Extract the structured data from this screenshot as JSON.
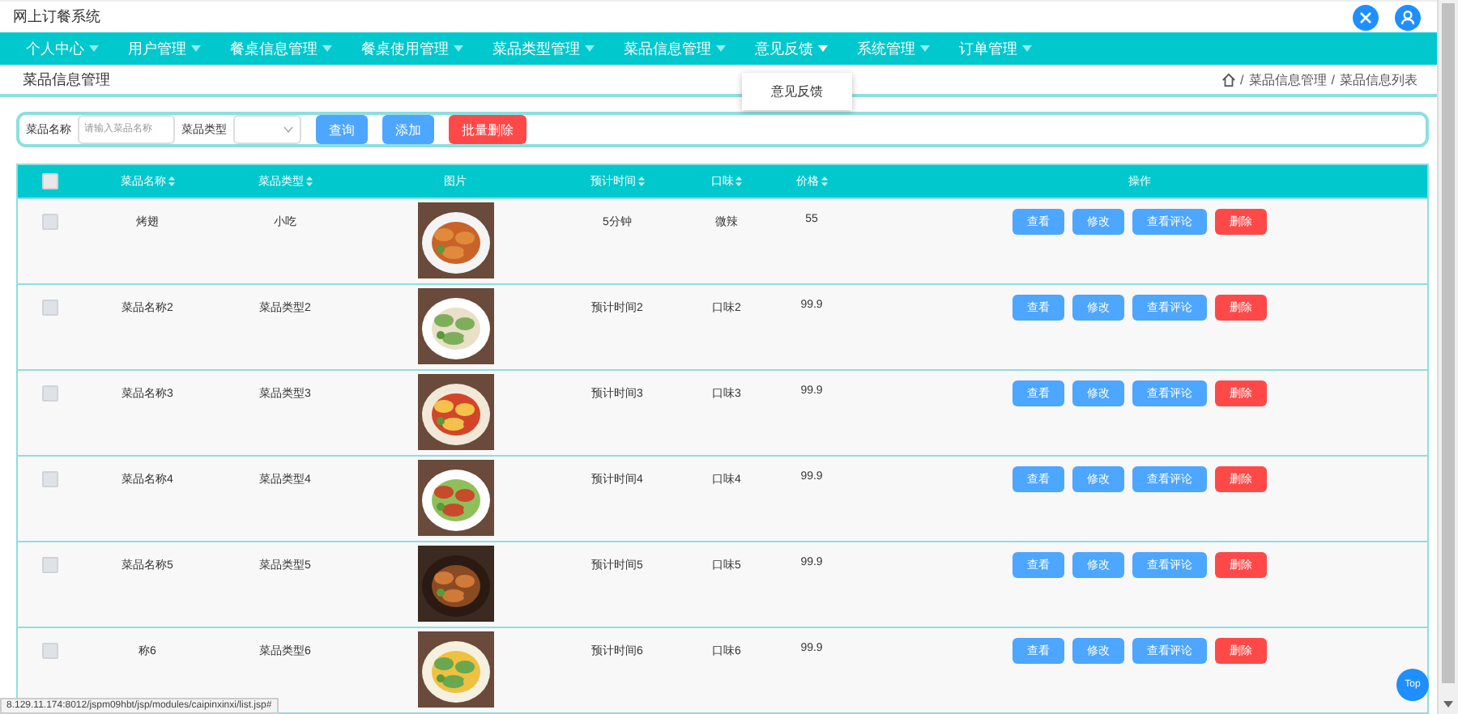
{
  "header": {
    "title": "网上订餐系统"
  },
  "nav": [
    {
      "label": "个人中心",
      "open": false
    },
    {
      "label": "用户管理",
      "open": false
    },
    {
      "label": "餐桌信息管理",
      "open": false
    },
    {
      "label": "餐桌使用管理",
      "open": false
    },
    {
      "label": "菜品类型管理",
      "open": false
    },
    {
      "label": "菜品信息管理",
      "open": false
    },
    {
      "label": "意见反馈",
      "open": true,
      "items": [
        "意见反馈"
      ]
    },
    {
      "label": "系统管理",
      "open": false
    },
    {
      "label": "订单管理",
      "open": false
    }
  ],
  "page_title": "菜品信息管理",
  "breadcrumb": {
    "separator": "/",
    "items": [
      "菜品信息管理",
      "菜品信息列表"
    ]
  },
  "search": {
    "name_label": "菜品名称",
    "name_placeholder": "请输入菜品名称",
    "type_label": "菜品类型",
    "buttons": [
      {
        "label": "查询",
        "kind": "primary"
      },
      {
        "label": "添加",
        "kind": "primary"
      },
      {
        "label": "批量删除",
        "kind": "danger"
      }
    ]
  },
  "table": {
    "all_checked": false,
    "columns": [
      "菜品名称",
      "菜品类型",
      "图片",
      "预计时间",
      "口味",
      "价格",
      "操作"
    ],
    "rows": [
      {
        "checked": false,
        "name": "烤翅",
        "type": "小吃",
        "time": "5分钟",
        "taste": "微辣",
        "price": "55",
        "actions": [
          "查看",
          "修改",
          "查看评论",
          "删除"
        ]
      },
      {
        "checked": false,
        "name": "菜品名称2",
        "type": "菜品类型2",
        "time": "预计时间2",
        "taste": "口味2",
        "price": "99.9",
        "actions": [
          "查看",
          "修改",
          "查看评论",
          "删除"
        ]
      },
      {
        "checked": false,
        "name": "菜品名称3",
        "type": "菜品类型3",
        "time": "预计时间3",
        "taste": "口味3",
        "price": "99.9",
        "actions": [
          "查看",
          "修改",
          "查看评论",
          "删除"
        ]
      },
      {
        "checked": false,
        "name": "菜品名称4",
        "type": "菜品类型4",
        "time": "预计时间4",
        "taste": "口味4",
        "price": "99.9",
        "actions": [
          "查看",
          "修改",
          "查看评论",
          "删除"
        ]
      },
      {
        "checked": false,
        "name": "菜品名称5",
        "type": "菜品类型5",
        "time": "预计时间5",
        "taste": "口味5",
        "price": "99.9",
        "actions": [
          "查看",
          "修改",
          "查看评论",
          "删除"
        ]
      },
      {
        "checked": false,
        "name": "称6",
        "type": "菜品类型6",
        "time": "预计时间6",
        "taste": "口味6",
        "price": "99.9",
        "actions": [
          "查看",
          "修改",
          "查看评论",
          "删除"
        ]
      }
    ]
  },
  "status_url": "8.129.11.174:8012/jspm09hbt/jsp/modules/caipinxinxi/list.jsp#",
  "top_button": "Top"
}
